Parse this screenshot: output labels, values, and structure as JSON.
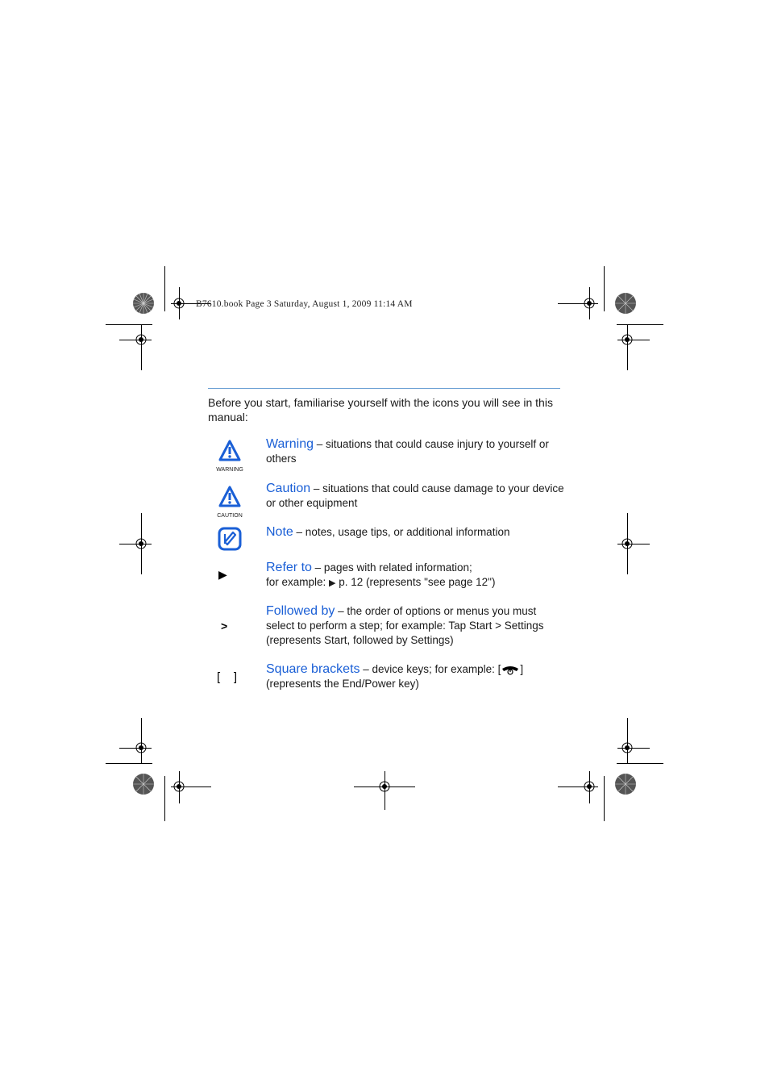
{
  "header": {
    "file_info": "B7610.book  Page 3  Saturday, August 1, 2009  11:14 AM"
  },
  "intro": "Before you start, familiarise yourself with the icons you will see in this manual:",
  "colors": {
    "accent": "#1a5fd6",
    "rule": "#6b9fd4"
  },
  "entries": [
    {
      "icon": "warning-icon",
      "icon_label": "WARNING",
      "term": "Warning",
      "desc": " – situations that could cause injury to yourself or others"
    },
    {
      "icon": "caution-icon",
      "icon_label": "CAUTION",
      "term": "Caution",
      "desc": " – situations that could cause damage to your device or other equipment"
    },
    {
      "icon": "note-icon",
      "term": "Note",
      "desc": " – notes, usage tips, or additional information"
    },
    {
      "icon": "arrow-right-icon",
      "glyph": "▶",
      "term": "Refer to",
      "desc1": " – pages with related information;",
      "desc2a": "for example: ",
      "desc2b": "▶",
      "desc2c": " p. 12 (represents \"see page 12\")"
    },
    {
      "icon": "greater-than-icon",
      "glyph": ">",
      "term": "Followed by",
      "desc1": " – the order of options or menus you must select to perform a step; for example: Tap ",
      "start": "Start",
      "sep": " > ",
      "settings": "Settings",
      "desc2": "(represents ",
      "start2": "Start",
      "mid": ", followed by ",
      "settings2": "Settings",
      "end": ")"
    },
    {
      "icon": "brackets-icon",
      "glyph": "[    ]",
      "term": "Square brackets",
      "desc1": " – device keys; for example: [",
      "desc1b": "]",
      "desc2": "(represents the End/Power key)"
    }
  ]
}
